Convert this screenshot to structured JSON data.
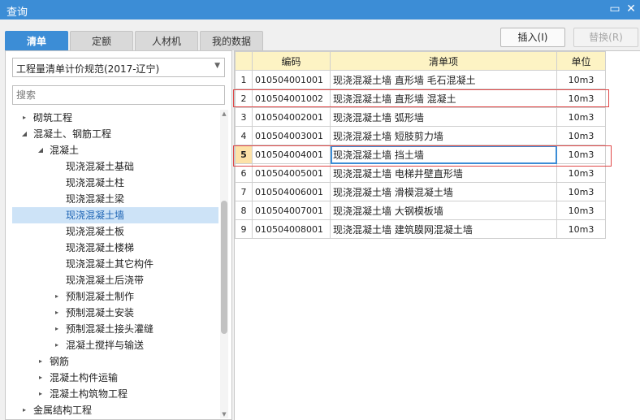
{
  "window": {
    "title": "查询",
    "restore_glyph": "▭",
    "close_glyph": "✕"
  },
  "tabs": [
    {
      "label": "清单",
      "active": true
    },
    {
      "label": "定额",
      "active": false
    },
    {
      "label": "人材机",
      "active": false
    },
    {
      "label": "我的数据",
      "active": false
    }
  ],
  "toolbar": {
    "insert_label": "插入(I)",
    "replace_label": "替换(R)"
  },
  "left": {
    "spec_select": {
      "value": "工程量清单计价规范(2017-辽宁)"
    },
    "search": {
      "placeholder": "搜索"
    },
    "tree": [
      {
        "label": "砌筑工程",
        "level": 0,
        "caret": "▸"
      },
      {
        "label": "混凝土、钢筋工程",
        "level": 0,
        "caret": "◢"
      },
      {
        "label": "混凝土",
        "level": 1,
        "caret": "◢"
      },
      {
        "label": "现浇混凝土基础",
        "level": 2,
        "caret": ""
      },
      {
        "label": "现浇混凝土柱",
        "level": 2,
        "caret": ""
      },
      {
        "label": "现浇混凝土梁",
        "level": 2,
        "caret": ""
      },
      {
        "label": "现浇混凝土墙",
        "level": 2,
        "caret": "",
        "selected": true
      },
      {
        "label": "现浇混凝土板",
        "level": 2,
        "caret": ""
      },
      {
        "label": "现浇混凝土楼梯",
        "level": 2,
        "caret": ""
      },
      {
        "label": "现浇混凝土其它构件",
        "level": 2,
        "caret": ""
      },
      {
        "label": "现浇混凝土后浇带",
        "level": 2,
        "caret": ""
      },
      {
        "label": "预制混凝土制作",
        "level": 2,
        "caret": "▸"
      },
      {
        "label": "预制混凝土安装",
        "level": 2,
        "caret": "▸"
      },
      {
        "label": "预制混凝土接头灌缝",
        "level": 2,
        "caret": "▸"
      },
      {
        "label": "混凝土搅拌与输送",
        "level": 2,
        "caret": "▸"
      },
      {
        "label": "钢筋",
        "level": 1,
        "caret": "▸"
      },
      {
        "label": "混凝土构件运输",
        "level": 1,
        "caret": "▸"
      },
      {
        "label": "混凝土构筑物工程",
        "level": 1,
        "caret": "▸"
      },
      {
        "label": "金属结构工程",
        "level": 0,
        "caret": "▸"
      }
    ]
  },
  "grid": {
    "columns": {
      "code": "编码",
      "name": "清单项",
      "unit": "单位"
    },
    "rows": [
      {
        "num": "1",
        "code": "010504001001",
        "name": "现浇混凝土墙 直形墙 毛石混凝土",
        "unit": "10m3"
      },
      {
        "num": "2",
        "code": "010504001002",
        "name": "现浇混凝土墙 直形墙 混凝土",
        "unit": "10m3"
      },
      {
        "num": "3",
        "code": "010504002001",
        "name": "现浇混凝土墙 弧形墙",
        "unit": "10m3"
      },
      {
        "num": "4",
        "code": "010504003001",
        "name": "现浇混凝土墙 短肢剪力墙",
        "unit": "10m3"
      },
      {
        "num": "5",
        "code": "010504004001",
        "name": "现浇混凝土墙 挡土墙",
        "unit": "10m3",
        "current": true
      },
      {
        "num": "6",
        "code": "010504005001",
        "name": "现浇混凝土墙 电梯井壁直形墙",
        "unit": "10m3"
      },
      {
        "num": "7",
        "code": "010504006001",
        "name": "现浇混凝土墙 滑模混凝土墙",
        "unit": "10m3"
      },
      {
        "num": "8",
        "code": "010504007001",
        "name": "现浇混凝土墙 大钢模板墙",
        "unit": "10m3"
      },
      {
        "num": "9",
        "code": "010504008001",
        "name": "现浇混凝土墙 建筑膜网混凝土墙",
        "unit": "10m3"
      }
    ]
  }
}
